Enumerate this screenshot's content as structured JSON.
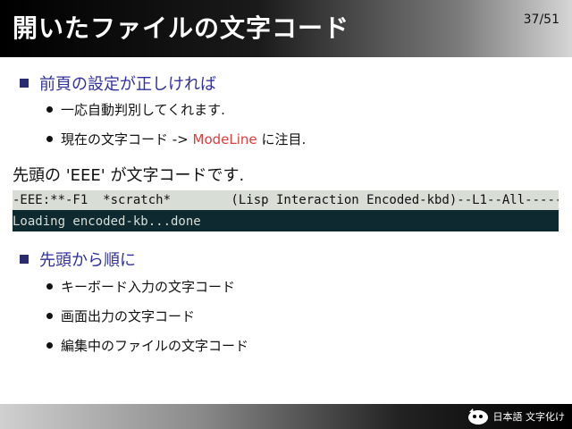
{
  "header": {
    "title": "開いたファイルの文字コード",
    "page": "37/51"
  },
  "section1": {
    "heading": "前頁の設定が正しければ",
    "items": [
      {
        "text": "一応自動判別してくれます."
      },
      {
        "prefix": "現在の文字コード -> ",
        "highlight": "ModeLine",
        "suffix": " に注目."
      }
    ]
  },
  "paragraph": "先頭の 'EEE' が文字コードです.",
  "terminal": {
    "modeline": "-EEE:**-F1  *scratch*        (Lisp Interaction Encoded-kbd)--L1--All-----------",
    "echo": "Loading encoded-kb...done"
  },
  "section2": {
    "heading": "先頭から順に",
    "items": [
      {
        "text": "キーボード入力の文字コード"
      },
      {
        "text": "画面出力の文字コード"
      },
      {
        "text": "編集中のファイルの文字コード"
      }
    ]
  },
  "footer": {
    "logo_text": "日本語 文字化け"
  },
  "colors": {
    "section": "#3030a0",
    "highlight": "#e03c3c",
    "terminal_bg": "#0e2a30"
  }
}
